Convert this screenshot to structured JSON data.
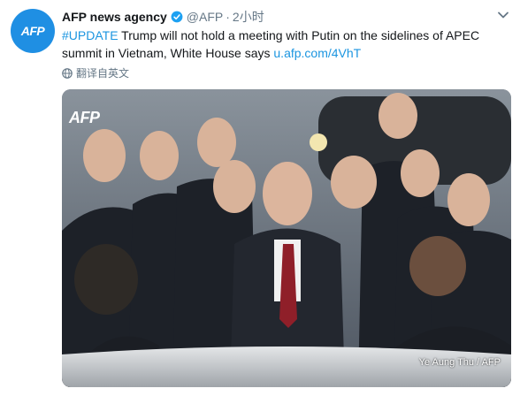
{
  "account": {
    "display_name": "AFP news agency",
    "handle": "@AFP",
    "separator": "·",
    "timestamp": "2小时",
    "avatar_logo": "AFP",
    "brand_color": "#1f8fe3",
    "verified_icon": "verified-badge-icon"
  },
  "tweet": {
    "hashtag": "#UPDATE",
    "body": " Trump will not hold a meeting with Putin on the sidelines of APEC summit in Vietnam, White House says ",
    "link": "u.afp.com/4VhT",
    "link_color": "#1b95e0"
  },
  "translate": {
    "label": "翻译自英文",
    "icon": "globe-icon"
  },
  "photo": {
    "logo": "AFP",
    "credit": "Ye Aung Thu / AFP"
  },
  "menu": {
    "icon": "chevron-down-icon"
  }
}
